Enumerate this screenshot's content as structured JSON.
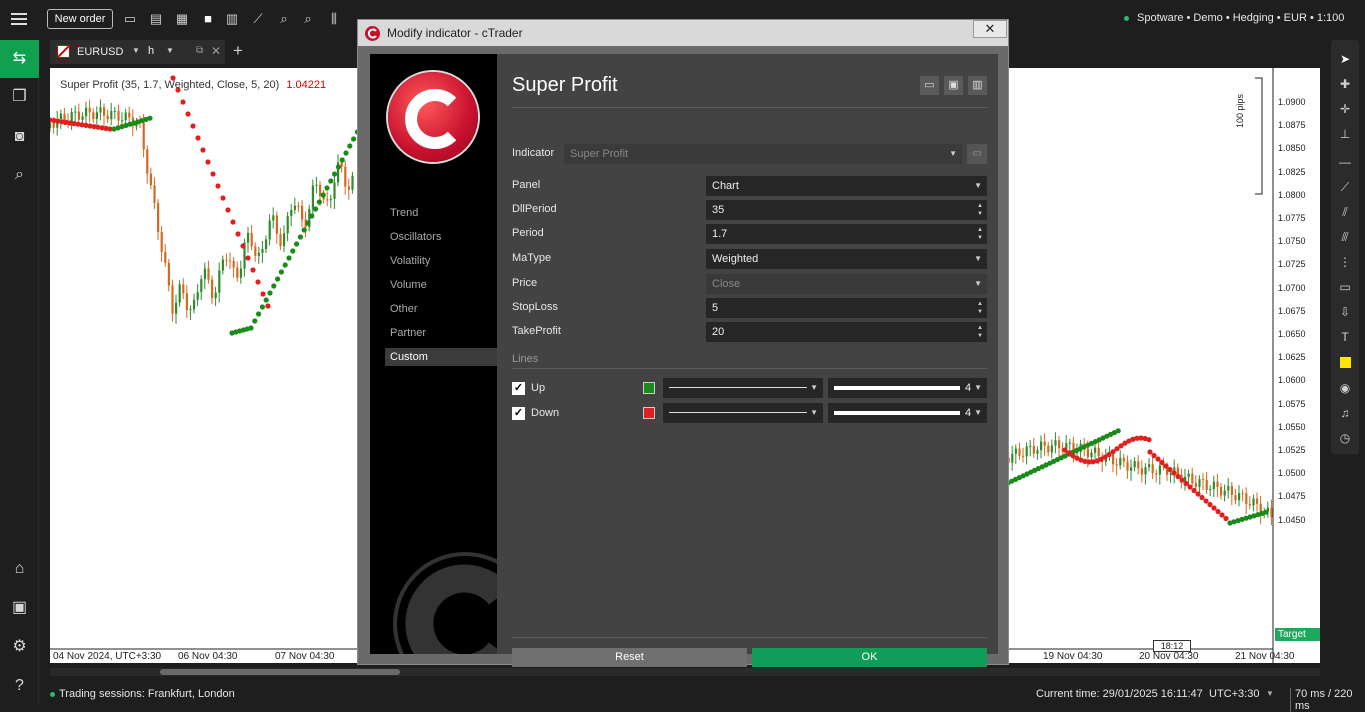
{
  "topbar": {
    "new_order_label": "New order",
    "account_info": "Spotware • Demo • Hedging • EUR • 1:100"
  },
  "chart_tab": {
    "symbol": "EURUSD",
    "timeframe": "h"
  },
  "chart": {
    "indicator_label": "Super Profit (35, 1.7, Weighted, Close, 5, 20)",
    "indicator_value": "1.04221",
    "pips_label": "100 pips",
    "price_ticks": [
      "1.0900",
      "1.0875",
      "1.0850",
      "1.0825",
      "1.0800",
      "1.0775",
      "1.0750",
      "1.0725",
      "1.0700",
      "1.0675",
      "1.0650",
      "1.0625",
      "1.0600",
      "1.0575",
      "1.0550",
      "1.0525",
      "1.0500",
      "1.0475",
      "1.0450"
    ],
    "time_ticks_left": [
      "04 Nov 2024, UTC+3:30",
      "06 Nov 04:30",
      "07 Nov 04:30"
    ],
    "time_ticks_right": [
      "19 Nov 04:30",
      "20 Nov 04:30",
      "21 Nov 04:30"
    ],
    "time_marker": "18:12",
    "target_label": "Target"
  },
  "dialog": {
    "title": "Modify indicator - cTrader",
    "heading": "Super Profit",
    "categories": [
      "Trend",
      "Oscillators",
      "Volatility",
      "Volume",
      "Other",
      "Partner",
      "Custom"
    ],
    "indicator_label": "Indicator",
    "indicator_value": "Super Profit",
    "params": [
      {
        "label": "Panel",
        "value": "Chart"
      },
      {
        "label": "DllPeriod",
        "value": "35"
      },
      {
        "label": "Period",
        "value": "1.7"
      },
      {
        "label": "MaType",
        "value": "Weighted"
      },
      {
        "label": "Price",
        "value": "Close"
      },
      {
        "label": "StopLoss",
        "value": "5"
      },
      {
        "label": "TakeProfit",
        "value": "20"
      }
    ],
    "lines_heading": "Lines",
    "lines": [
      {
        "label": "Up",
        "color": "#1a8a1a",
        "thickness": "4"
      },
      {
        "label": "Down",
        "color": "#e02020",
        "thickness": "4"
      }
    ],
    "reset_label": "Reset",
    "ok_label": "OK"
  },
  "statusbar": {
    "sessions": "Trading sessions: Frankfurt, London",
    "current_time": "Current time:  29/01/2025 16:11:47",
    "timezone": "UTC+3:30",
    "latency": "70 ms / 220 ms"
  },
  "colors": {
    "accent_green": "#0f9d58",
    "up_dot": "#1a8a1a",
    "down_dot": "#e02020"
  }
}
